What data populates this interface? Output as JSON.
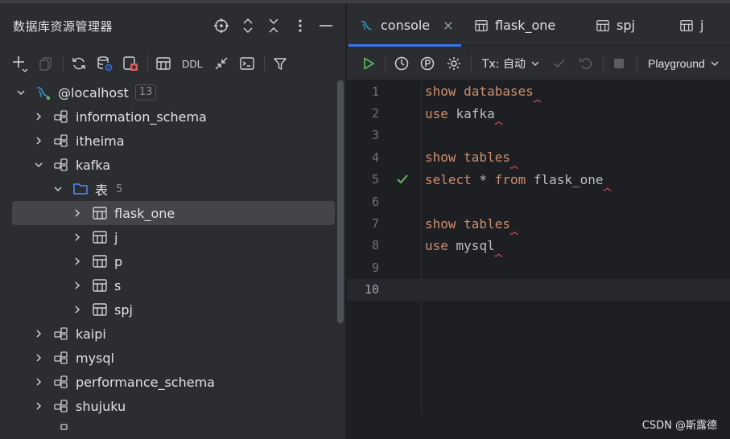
{
  "left_panel": {
    "title": "数据库资源管理器",
    "toolbar": {
      "ddl_label": "DDL"
    },
    "tree": {
      "root": {
        "label": "@localhost",
        "badge": "13"
      },
      "db_information_schema": "information_schema",
      "db_itheima": "itheima",
      "db_kafka": "kafka",
      "folder_tables": {
        "label": "表",
        "count": "5"
      },
      "table_flask_one": "flask_one",
      "table_j": "j",
      "table_p": "p",
      "table_s": "s",
      "table_spj": "spj",
      "db_kaipi": "kaipi",
      "db_mysql": "mysql",
      "db_performance_schema": "performance_schema",
      "db_shujuku": "shujuku"
    }
  },
  "tabs": [
    {
      "label": "console",
      "close": "×"
    },
    {
      "label": "flask_one"
    },
    {
      "label": "spj"
    },
    {
      "label": "j"
    }
  ],
  "editor_toolbar": {
    "tx_label": "Tx: 自动",
    "playground_label": "Playground"
  },
  "editor": {
    "lines": [
      {
        "num": "1",
        "kw": "show databases",
        "rest": ""
      },
      {
        "num": "2",
        "kw": "use",
        "rest": " kafka"
      },
      {
        "num": "3",
        "kw": "",
        "rest": ""
      },
      {
        "num": "4",
        "kw": "show tables",
        "rest": ""
      },
      {
        "num": "5",
        "kw": "select",
        "rest": " * ",
        "kw2": "from",
        "rest2": " flask_one"
      },
      {
        "num": "6",
        "kw": "",
        "rest": ""
      },
      {
        "num": "7",
        "kw": "show tables",
        "rest": ""
      },
      {
        "num": "8",
        "kw": "use",
        "rest": " mysql"
      },
      {
        "num": "9",
        "kw": "",
        "rest": ""
      },
      {
        "num": "10",
        "kw": "",
        "rest": ""
      }
    ]
  },
  "watermark": "CSDN @斯露德",
  "colors": {
    "accent": "#3574f0",
    "keyword": "#cf8e6d",
    "success": "#5fb865",
    "selection": "#43454a"
  }
}
